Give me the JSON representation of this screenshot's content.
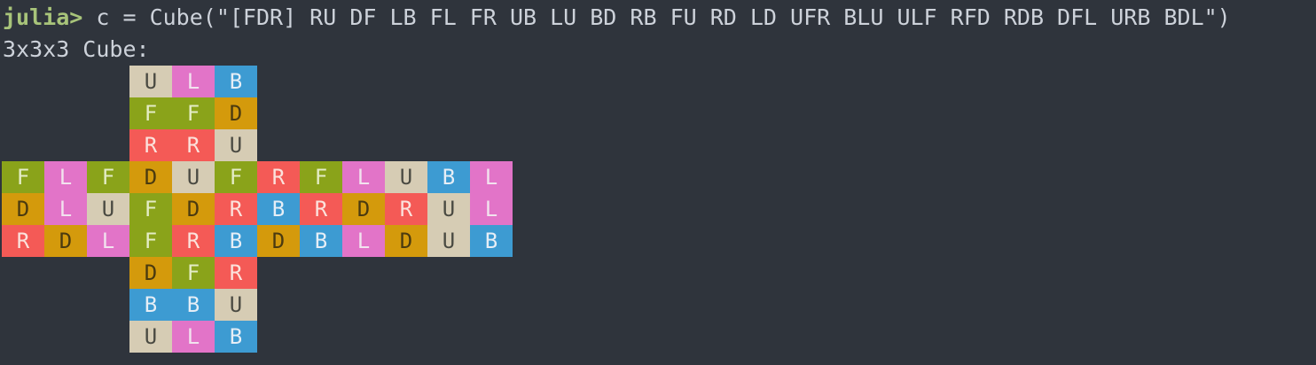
{
  "terminal": {
    "prompt": "julia>",
    "command": " c = Cube(\"[FDR] RU DF LB FL FR UB LU BD RB FU RD LD UFR BLU ULF RFD RDB DFL URB BDL\")",
    "output_header": "3x3x3 Cube:"
  },
  "colors": {
    "background": "#2f343c",
    "text": "#cdd2da",
    "prompt": "#a8c47a",
    "U": "#d6ccb4",
    "L": "#e274c8",
    "B": "#3d9bd2",
    "F": "#8aa31a",
    "D": "#d49a0c",
    "R": "#f45a56",
    "label_U": "#4a4a42",
    "label_L": "#f2e2ee",
    "label_B": "#e6eef6",
    "label_F": "#e4ecc6",
    "label_D": "#4a3a10",
    "label_R": "#fbe2dc"
  },
  "cube": {
    "rows": [
      [
        "",
        "",
        "",
        "U",
        "L",
        "B",
        "",
        "",
        "",
        "",
        "",
        ""
      ],
      [
        "",
        "",
        "",
        "F",
        "F",
        "D",
        "",
        "",
        "",
        "",
        "",
        ""
      ],
      [
        "",
        "",
        "",
        "R",
        "R",
        "U",
        "",
        "",
        "",
        "",
        "",
        ""
      ],
      [
        "F",
        "L",
        "F",
        "D",
        "U",
        "F",
        "R",
        "F",
        "L",
        "U",
        "B",
        "L"
      ],
      [
        "D",
        "L",
        "U",
        "F",
        "D",
        "R",
        "B",
        "R",
        "D",
        "R",
        "U",
        "L"
      ],
      [
        "R",
        "D",
        "L",
        "F",
        "R",
        "B",
        "D",
        "B",
        "L",
        "D",
        "U",
        "B"
      ],
      [
        "",
        "",
        "",
        "D",
        "F",
        "R",
        "",
        "",
        "",
        "",
        "",
        ""
      ],
      [
        "",
        "",
        "",
        "B",
        "B",
        "U",
        "",
        "",
        "",
        "",
        "",
        ""
      ],
      [
        "",
        "",
        "",
        "U",
        "L",
        "B",
        "",
        "",
        "",
        "",
        "",
        ""
      ]
    ]
  }
}
